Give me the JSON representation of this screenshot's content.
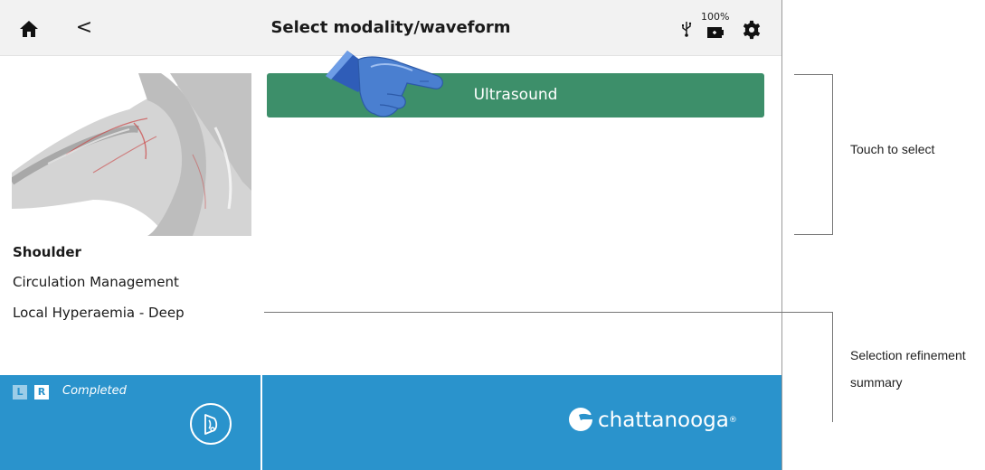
{
  "header": {
    "title": "Select modality/waveform",
    "battery_percent": "100%",
    "icons": {
      "home": "home-icon",
      "back": "back-chevron-icon",
      "usb": "usb-icon",
      "battery": "battery-icon",
      "settings": "gear-icon"
    },
    "back_glyph": "<"
  },
  "selection": {
    "body_part": "Shoulder",
    "category": "Circulation Management",
    "protocol": "Local Hyperaemia - Deep"
  },
  "options": [
    {
      "label": "Ultrasound"
    }
  ],
  "footer": {
    "side_left": "L",
    "side_right": "R",
    "status": "Completed",
    "brand": "chattanooga",
    "brand_mark": "®"
  },
  "annotations": {
    "touch_to_select": "Touch to select",
    "selection_summary": "Selection refinement summary"
  },
  "colors": {
    "option_button": "#3d8f6a",
    "footer_blue": "#2a93cc",
    "header_bg": "#f2f2f2",
    "hand_blue": "#4a7fd0"
  }
}
